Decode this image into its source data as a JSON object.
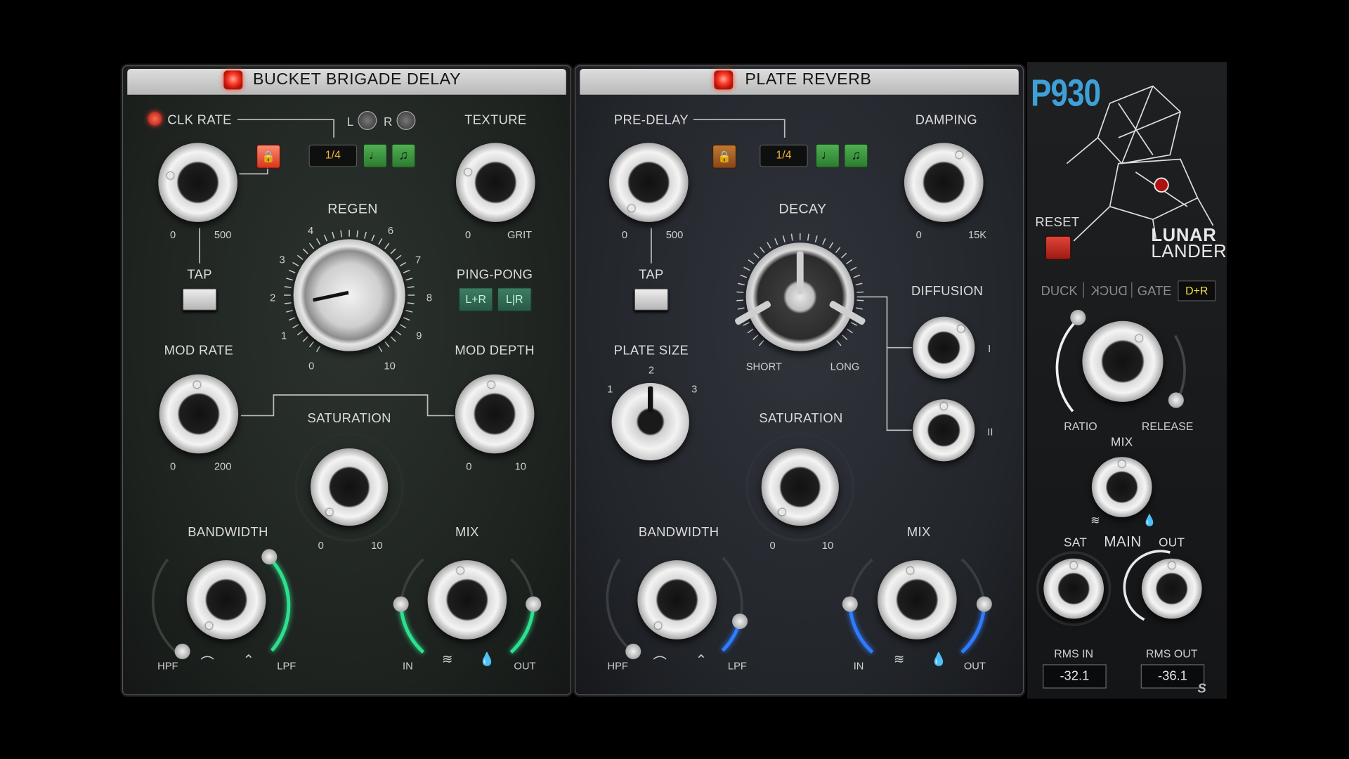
{
  "delay": {
    "title": "BUCKET BRIGADE DELAY",
    "clk_rate": {
      "label": "CLK RATE",
      "min": "0",
      "max": "500"
    },
    "lr": {
      "l": "L",
      "r": "R"
    },
    "sync": {
      "value": "1/4",
      "note": "♩",
      "notes": "♫"
    },
    "texture": {
      "label": "TEXTURE",
      "min": "0",
      "max": "GRIT"
    },
    "regen": {
      "label": "REGEN",
      "ticks": [
        "0",
        "1",
        "2",
        "3",
        "4",
        "6",
        "7",
        "8",
        "9",
        "10"
      ]
    },
    "tap": {
      "label": "TAP"
    },
    "ping_pong": {
      "label": "PING-PONG",
      "a": "L+R",
      "b": "L|R"
    },
    "mod_rate": {
      "label": "MOD RATE",
      "min": "0",
      "max": "200"
    },
    "mod_depth": {
      "label": "MOD DEPTH",
      "min": "0",
      "max": "10"
    },
    "saturation": {
      "label": "SATURATION",
      "min": "0",
      "max": "10"
    },
    "bandwidth": {
      "label": "BANDWIDTH",
      "hpf": "HPF",
      "lpf": "LPF"
    },
    "mix": {
      "label": "MIX",
      "in": "IN",
      "out": "OUT"
    }
  },
  "reverb": {
    "title": "PLATE REVERB",
    "pre_delay": {
      "label": "PRE-DELAY",
      "min": "0",
      "max": "500"
    },
    "sync": {
      "value": "1/4",
      "note": "♩",
      "notes": "♫"
    },
    "damping": {
      "label": "DAMPING",
      "min": "0",
      "max": "15K"
    },
    "decay": {
      "label": "DECAY",
      "min": "SHORT",
      "max": "LONG"
    },
    "tap": {
      "label": "TAP"
    },
    "diffusion": {
      "label": "DIFFUSION",
      "i": "I",
      "ii": "II"
    },
    "plate_size": {
      "label": "PLATE SIZE",
      "t1": "1",
      "t2": "2",
      "t3": "3"
    },
    "saturation": {
      "label": "SATURATION",
      "min": "0",
      "max": "10"
    },
    "bandwidth": {
      "label": "BANDWIDTH",
      "hpf": "HPF",
      "lpf": "LPF"
    },
    "mix": {
      "label": "MIX",
      "in": "IN",
      "out": "OUT"
    }
  },
  "p930": {
    "logo": "P930",
    "reset": "RESET",
    "brand_line1": "LUNAR",
    "brand_line2": "LANDER",
    "modes": [
      "DUCK",
      "DUCK",
      "GATE",
      "D+R"
    ],
    "ratio": "RATIO",
    "release": "RELEASE",
    "mix": "MIX",
    "sat": "SAT",
    "main": "MAIN",
    "out": "OUT",
    "rms_in_label": "RMS IN",
    "rms_out_label": "RMS OUT",
    "rms_in": "-32.1",
    "rms_out": "-36.1",
    "corner_logo": "S"
  },
  "colors": {
    "accent_green": "#2ee08e",
    "accent_blue": "#2f7cff",
    "led_red": "#ff3d2b",
    "readout_amber": "#f0b23a",
    "logo_blue": "#3ea0d6"
  }
}
